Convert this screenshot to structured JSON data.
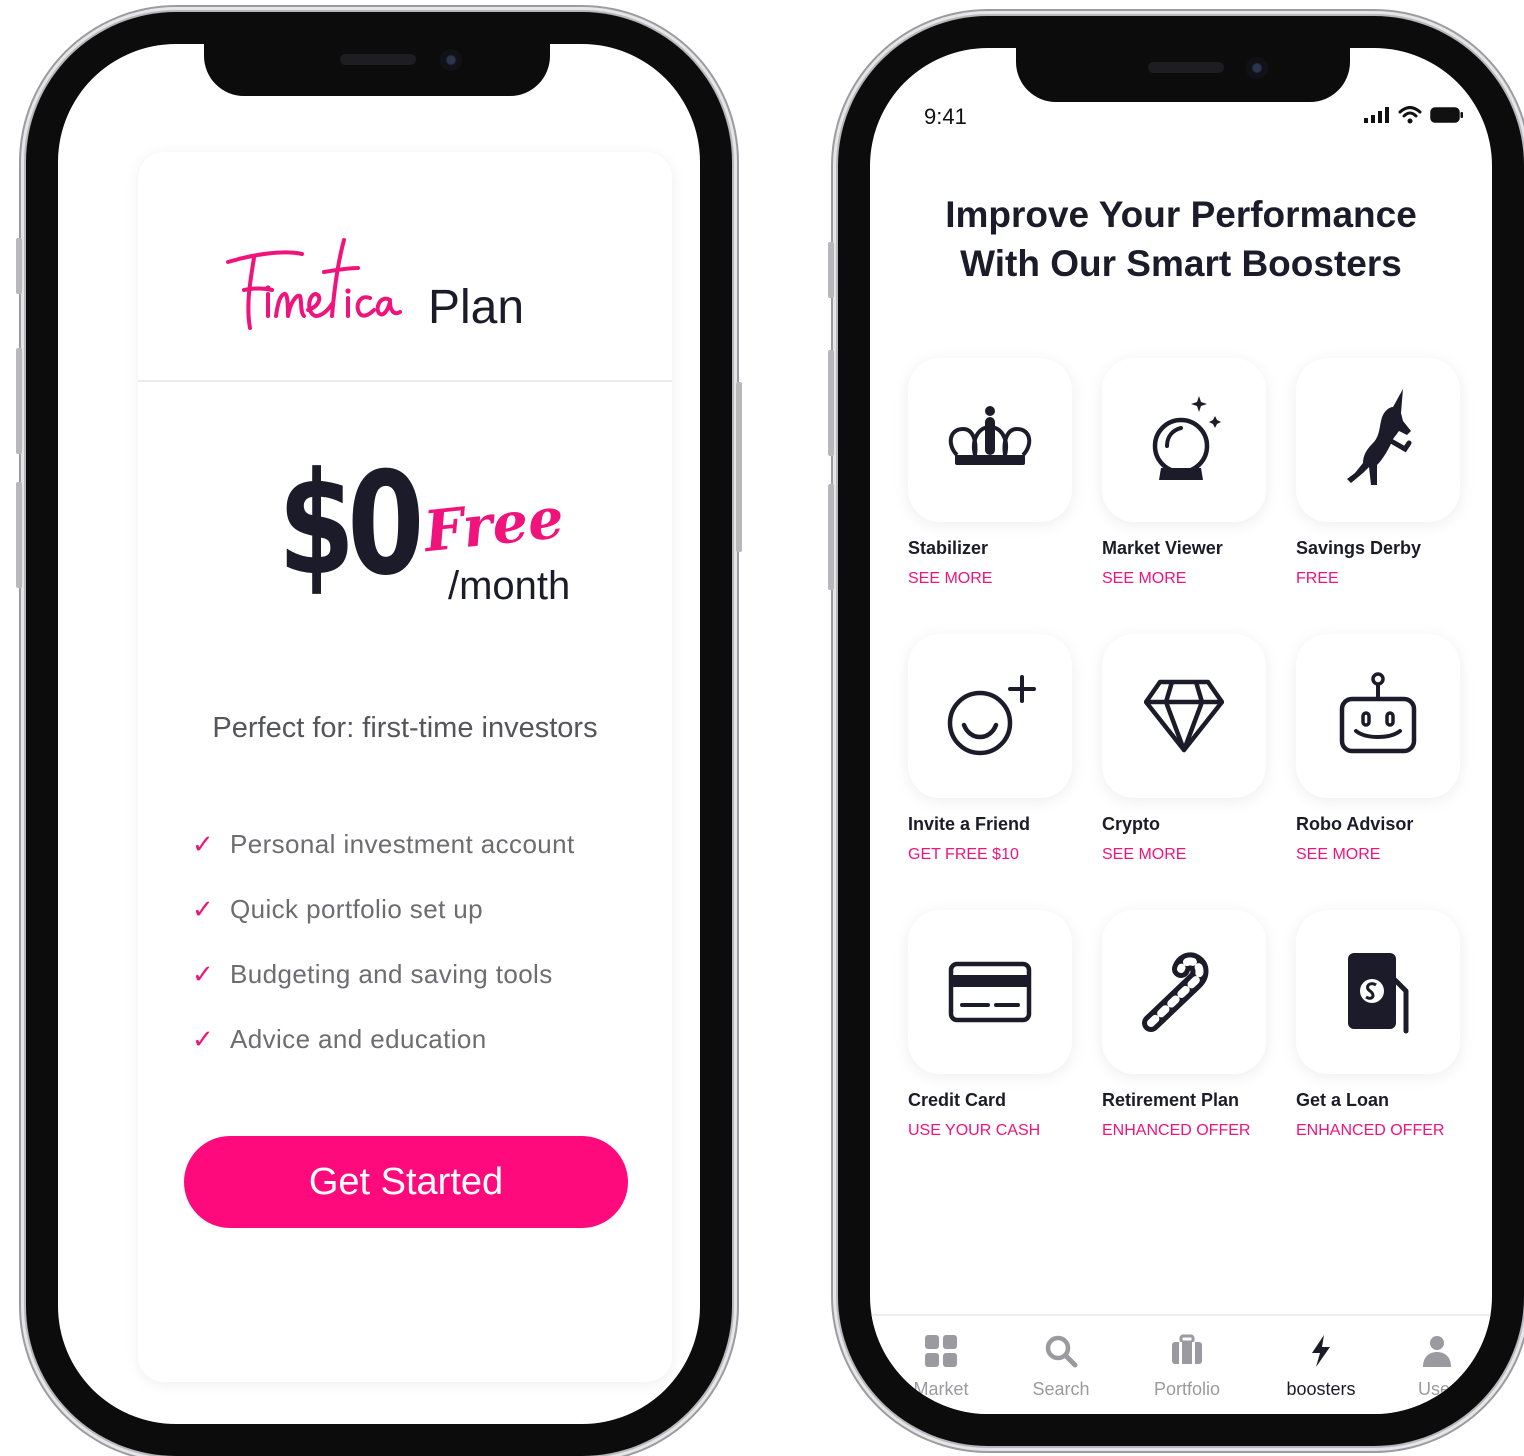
{
  "plan_screen": {
    "logo_text": "Finetica",
    "plan_label": "Plan",
    "price": "$0",
    "price_tag": "Free",
    "price_period": "/month",
    "perfect_for": "Perfect for: first-time investors",
    "features": [
      "Personal investment account",
      "Quick portfolio set up",
      "Budgeting  and saving tools",
      "Advice and education"
    ],
    "cta_label": "Get Started"
  },
  "boosters_screen": {
    "status_time": "9:41",
    "headline_line1": "Improve Your Performance",
    "headline_line2": "With Our Smart Boosters",
    "boosters": [
      {
        "name": "Stabilizer",
        "action": "SEE MORE",
        "icon": "crown-icon"
      },
      {
        "name": "Market Viewer",
        "action": "SEE MORE",
        "icon": "crystal-ball-icon"
      },
      {
        "name": "Savings Derby",
        "action": "FREE",
        "icon": "unicorn-icon"
      },
      {
        "name": "Invite a Friend",
        "action": "GET FREE $10",
        "icon": "add-friend-icon"
      },
      {
        "name": "Crypto",
        "action": "SEE MORE",
        "icon": "diamond-icon"
      },
      {
        "name": "Robo Advisor",
        "action": "SEE MORE",
        "icon": "robot-icon"
      },
      {
        "name": "Credit Card",
        "action": "USE YOUR CASH",
        "icon": "credit-card-icon"
      },
      {
        "name": "Retirement Plan",
        "action": "ENHANCED OFFER",
        "icon": "candy-cane-icon"
      },
      {
        "name": "Get a Loan",
        "action": "ENHANCED OFFER",
        "icon": "cash-hand-icon"
      }
    ],
    "tabs": [
      {
        "label": "Market",
        "icon": "grid-icon",
        "active": false
      },
      {
        "label": "Search",
        "icon": "search-icon",
        "active": false
      },
      {
        "label": "Portfolio",
        "icon": "briefcase-icon",
        "active": false
      },
      {
        "label": "boosters",
        "icon": "lightning-icon",
        "active": true
      },
      {
        "label": "User",
        "icon": "user-icon",
        "active": false
      }
    ]
  },
  "colors": {
    "accent": "#f0137b",
    "button": "#ff0a7c",
    "text_dark": "#1c1b29",
    "text_muted": "#6c6c72"
  }
}
